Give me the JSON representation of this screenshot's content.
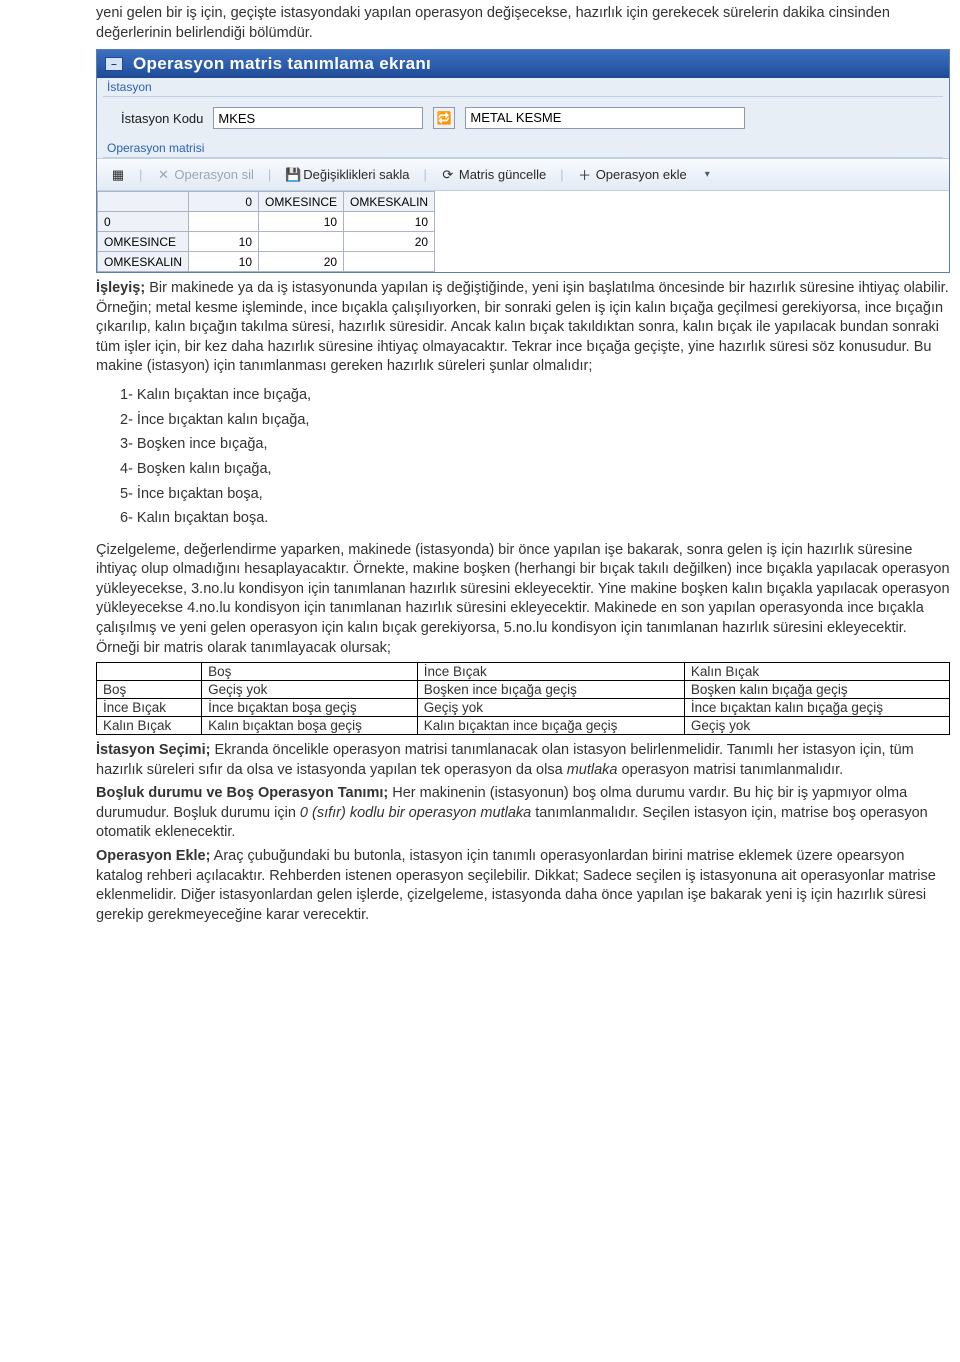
{
  "intro": "yeni gelen bir iş için, geçişte istasyondaki yapılan operasyon değişecekse, hazırlık için gerekecek sürelerin dakika cinsinden değerlerinin belirlendiği bölümdür.",
  "window": {
    "title": "Operasyon matris tanımlama ekranı",
    "group_station": "İstasyon",
    "station_code_label": "İstasyon Kodu",
    "station_code_value": "MKES",
    "station_desc_value": "METAL KESME",
    "group_matrix": "Operasyon matrisi",
    "toolbar": {
      "delete": "Operasyon sil",
      "save": "Değişiklikleri sakla",
      "update": "Matris güncelle",
      "add": "Operasyon ekle"
    },
    "matrix": {
      "col_headers": [
        "0",
        "OMKESINCE",
        "OMKESKALIN"
      ],
      "rows": [
        {
          "head": "0",
          "cells": [
            "",
            "10",
            "10"
          ]
        },
        {
          "head": "OMKESINCE",
          "cells": [
            "10",
            "",
            "20"
          ]
        },
        {
          "head": "OMKESKALIN",
          "cells": [
            "10",
            "20",
            ""
          ]
        }
      ]
    }
  },
  "paragraph1": "İşleyiş; Bir makinede ya da iş istasyonunda yapılan iş değiştiğinde, yeni işin başlatılma öncesinde bir hazırlık süresine ihtiyaç olabilir. Örneğin; metal kesme işleminde, ince bıçakla çalışılıyorken, bir sonraki gelen iş için kalın bıçağa geçilmesi gerekiyorsa, ince bıçağın çıkarılıp, kalın bıçağın takılma süresi, hazırlık süresidir. Ancak kalın bıçak takıldıktan sonra, kalın bıçak ile yapılacak bundan sonraki tüm işler için, bir kez daha hazırlık süresine ihtiyaç olmayacaktır. Tekrar ince bıçağa geçişte, yine hazırlık süresi söz konusudur. Bu makine (istasyon) için tanımlanması gereken hazırlık süreleri şunlar olmalıdır;",
  "isleyis_head": "İşleyiş;",
  "list": [
    "Kalın bıçaktan ince bıçağa,",
    "İnce bıçaktan kalın bıçağa,",
    "Boşken ince bıçağa,",
    "Boşken kalın bıçağa,",
    "İnce bıçaktan boşa,",
    "Kalın bıçaktan boşa."
  ],
  "paragraph2": "Çizelgeleme, değerlendirme yaparken, makinede (istasyonda) bir önce yapılan işe bakarak, sonra gelen iş için hazırlık süresine ihtiyaç olup olmadığını hesaplayacaktır. Örnekte, makine boşken (herhangi bir bıçak takılı değilken) ince bıçakla yapılacak operasyon yükleyecekse, 3.no.lu kondisyon için tanımlanan hazırlık süresini ekleyecektir. Yine makine boşken kalın bıçakla yapılacak operasyon yükleyecekse 4.no.lu kondisyon için tanımlanan hazırlık süresini ekleyecektir. Makinede en son yapılan operasyonda ince bıçakla çalışılmış ve yeni gelen operasyon için kalın bıçak gerekiyorsa, 5.no.lu kondisyon için tanımlanan hazırlık süresini ekleyecektir. Örneği bir matris olarak tanımlayacak olursak;",
  "example_table": {
    "cols": [
      "",
      "Boş",
      "İnce Bıçak",
      "Kalın Bıçak"
    ],
    "rows": [
      [
        "Boş",
        "Geçiş yok",
        "Boşken ince bıçağa geçiş",
        "Boşken kalın bıçağa geçiş"
      ],
      [
        "İnce Bıçak",
        "İnce bıçaktan boşa geçiş",
        "Geçiş yok",
        "İnce bıçaktan kalın bıçağa geçiş"
      ],
      [
        "Kalın Bıçak",
        "Kalın bıçaktan boşa geçiş",
        "Kalın bıçaktan ince bıçağa geçiş",
        "Geçiş yok"
      ]
    ]
  },
  "para_istasyon_head": "İstasyon Seçimi;",
  "para_istasyon": " Ekranda öncelikle operasyon matrisi tanımlanacak olan istasyon belirlenmelidir. Tanımlı her istasyon için, tüm hazırlık süreleri sıfır da olsa ve istasyonda yapılan tek operasyon da olsa ",
  "para_istasyon_italic": "mutlaka",
  "para_istasyon_tail": " operasyon matrisi tanımlanmalıdır.",
  "para_bos_head": "Boşluk durumu ve Boş Operasyon Tanımı;",
  "para_bos1": " Her makinenin (istasyonun) boş olma durumu vardır. Bu hiç bir iş yapmıyor olma durumudur. Boşluk durumu için ",
  "para_bos_italic": "0 (sıfır) kodlu bir operasyon mutlaka",
  "para_bos2": " tanımlanmalıdır. Seçilen istasyon için, matrise boş operasyon otomatik eklenecektir.",
  "para_op_head": "Operasyon Ekle;",
  "para_op": " Araç çubuğundaki bu butonla, istasyon için tanımlı operasyonlardan birini matrise eklemek üzere opearsyon katalog rehberi açılacaktır. Rehberden istenen operasyon seçilebilir. Dikkat; Sadece seçilen iş istasyonuna ait operasyonlar matrise eklenmelidir. Diğer istasyonlardan gelen işlerde, çizelgeleme, istasyonda daha önce yapılan işe bakarak yeni iş için hazırlık süresi gerekip gerekmeyeceğine karar verecektir."
}
